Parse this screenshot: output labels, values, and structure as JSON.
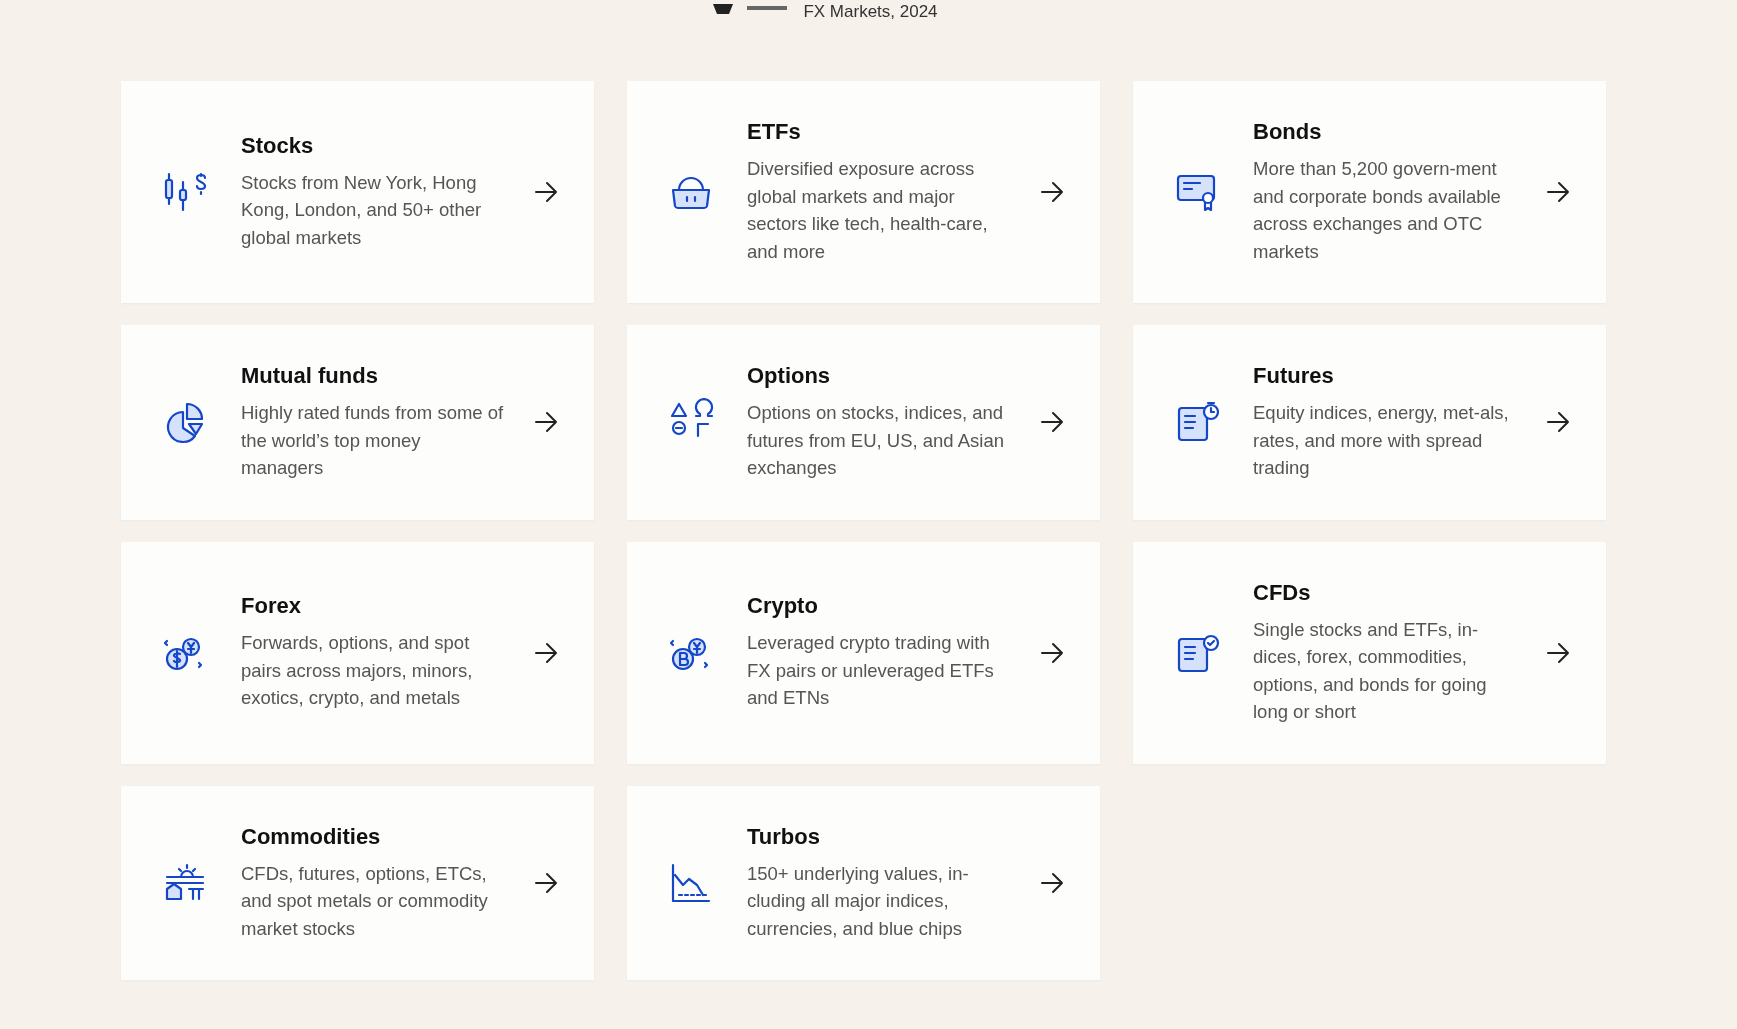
{
  "award": {
    "caption": "FX Markets, 2024"
  },
  "products": [
    {
      "title": "Stocks",
      "description": "Stocks from New York, Hong Kong, London, and 50+ other global markets"
    },
    {
      "title": "ETFs",
      "description": "Diversified exposure across global markets and major sectors like tech, health-care, and more"
    },
    {
      "title": "Bonds",
      "description": "More than 5,200 govern-ment and corporate bonds available across exchanges and OTC markets"
    },
    {
      "title": "Mutual funds",
      "description": "Highly rated funds from some of the world’s top money managers"
    },
    {
      "title": "Options",
      "description": "Options on stocks, indices, and futures from EU, US, and Asian exchanges"
    },
    {
      "title": "Futures",
      "description": "Equity indices, energy, met-als, rates, and more with spread trading"
    },
    {
      "title": "Forex",
      "description": "Forwards, options, and spot pairs across majors, minors, exotics, crypto, and metals"
    },
    {
      "title": "Crypto",
      "description": "Leveraged crypto trading with FX pairs or unleveraged ETFs and ETNs"
    },
    {
      "title": "CFDs",
      "description": "Single stocks and ETFs, in-dices, forex, commodities, options, and bonds for going long or short"
    },
    {
      "title": "Commodities",
      "description": "CFDs, futures, options, ETCs, and spot metals or commodity market stocks"
    },
    {
      "title": "Turbos",
      "description": "150+ underlying values, in-cluding all major indices, currencies, and blue chips"
    }
  ]
}
